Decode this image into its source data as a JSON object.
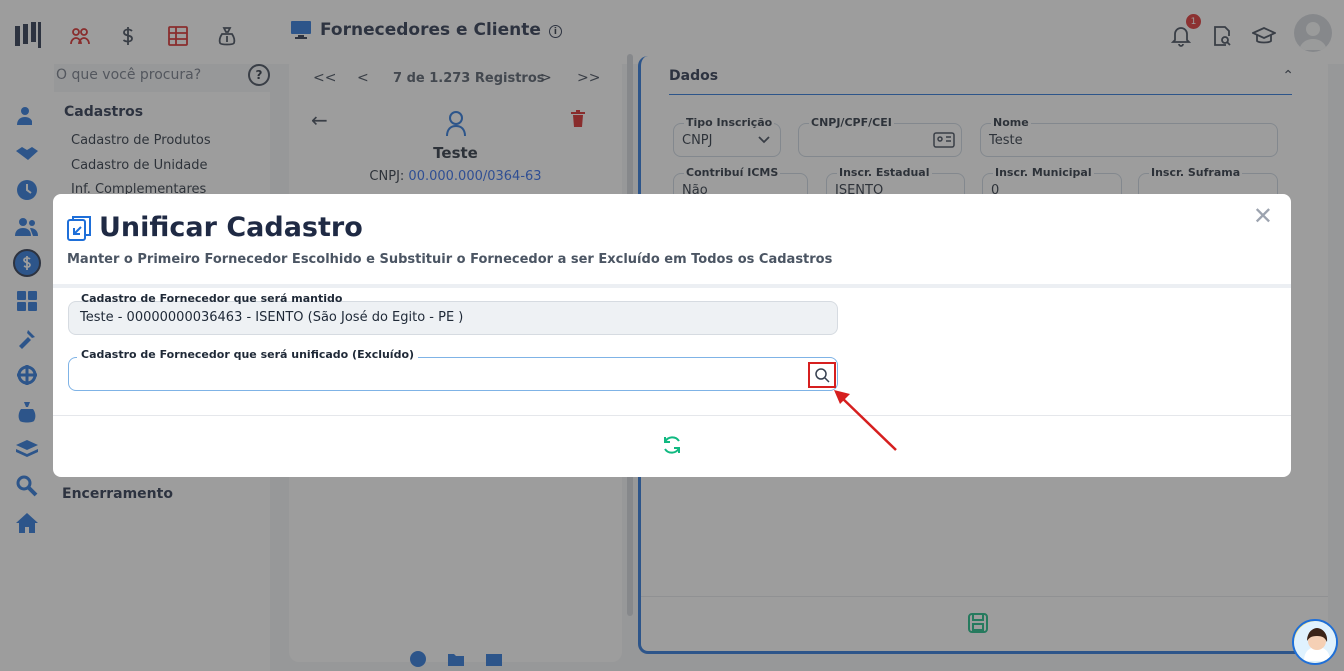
{
  "header": {
    "title": "Fornecedores e Cliente",
    "notification_count": "1"
  },
  "search": {
    "placeholder": "O que você procura?",
    "help": "?"
  },
  "menu": {
    "section": "Cadastros",
    "items": [
      "Cadastro de Produtos",
      "Cadastro de Unidade",
      "Inf. Complementares"
    ],
    "footer_section": "Encerramento"
  },
  "record": {
    "first": "<<",
    "prev": "<",
    "count": "7 de 1.273 Registros",
    "next": ">",
    "last": ">>",
    "name": "Teste",
    "cnpj_label": "CNPJ:",
    "cnpj_value": "00.000.000/0364-63"
  },
  "dados": {
    "title": "Dados",
    "fields": {
      "tipo_inscricao": {
        "label": "Tipo Inscrição",
        "value": "CNPJ"
      },
      "cnpj": {
        "label": "CNPJ/CPF/CEI",
        "value": ""
      },
      "nome": {
        "label": "Nome",
        "value": "Teste"
      },
      "icms": {
        "label": "Contribuí ICMS",
        "value": "Não"
      },
      "estadual": {
        "label": "Inscr. Estadual",
        "value": "ISENTO"
      },
      "municipal": {
        "label": "Inscr. Municipal",
        "value": "0"
      },
      "suframa": {
        "label": "Inscr. Suframa",
        "value": ""
      }
    }
  },
  "modal": {
    "title": "Unificar Cadastro",
    "subtitle": "Manter o Primeiro Fornecedor Escolhido e Substituir o Fornecedor a ser Excluído em Todos os Cadastros",
    "kept_label": "Cadastro de Fornecedor que será mantido",
    "kept_value": "Teste - 00000000036463 - ISENTO (São José do Egito - PE              )",
    "merge_label": "Cadastro de Fornecedor que será unificado (Excluído)",
    "merge_value": ""
  },
  "colors": {
    "accent": "#1e6fd9",
    "danger": "#d61f1f",
    "success": "#10b981",
    "title": "#1f2a44"
  },
  "icons": [
    "logo",
    "users-icon",
    "dollar-icon",
    "table-icon",
    "money-bag-icon",
    "bell-icon",
    "document-search-icon",
    "graduation-cap-icon",
    "user-avatar",
    "filter-icon",
    "search-icon",
    "refresh-icon",
    "save-icon",
    "trash-icon",
    "back-arrow-icon",
    "merge-icon"
  ]
}
